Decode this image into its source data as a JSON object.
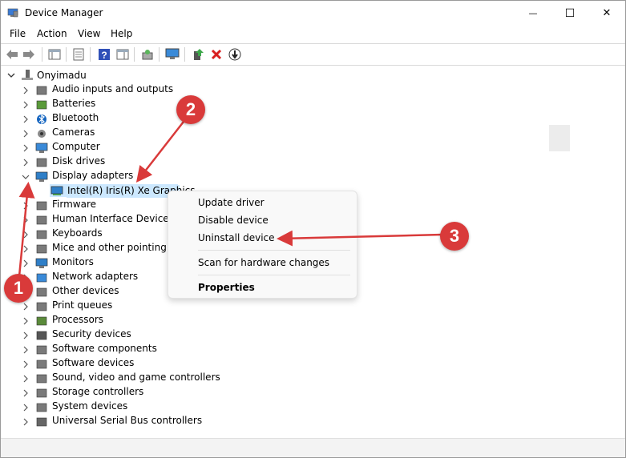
{
  "window": {
    "title": "Device Manager",
    "controls": {
      "minimize": "—",
      "maximize": "☐",
      "close": "✕"
    }
  },
  "menu": [
    "File",
    "Action",
    "View",
    "Help"
  ],
  "tree": {
    "root": "Onyimadu",
    "categories": [
      {
        "label": "Audio inputs and outputs",
        "icon": "speaker-icon"
      },
      {
        "label": "Batteries",
        "icon": "battery-icon"
      },
      {
        "label": "Bluetooth",
        "icon": "bluetooth-icon"
      },
      {
        "label": "Cameras",
        "icon": "camera-icon"
      },
      {
        "label": "Computer",
        "icon": "computer-icon"
      },
      {
        "label": "Disk drives",
        "icon": "disk-icon"
      },
      {
        "label": "Display adapters",
        "icon": "display-icon",
        "expanded": true
      },
      {
        "label": "Firmware",
        "icon": "chip-icon"
      },
      {
        "label": "Human Interface Devices",
        "icon": "hid-icon"
      },
      {
        "label": "Keyboards",
        "icon": "keyboard-icon"
      },
      {
        "label": "Mice and other pointing de",
        "icon": "mouse-icon"
      },
      {
        "label": "Monitors",
        "icon": "monitor-icon"
      },
      {
        "label": "Network adapters",
        "icon": "network-icon"
      },
      {
        "label": "Other devices",
        "icon": "unknown-device-icon"
      },
      {
        "label": "Print queues",
        "icon": "printer-icon"
      },
      {
        "label": "Processors",
        "icon": "processor-icon"
      },
      {
        "label": "Security devices",
        "icon": "security-icon"
      },
      {
        "label": "Software components",
        "icon": "component-icon"
      },
      {
        "label": "Software devices",
        "icon": "software-device-icon"
      },
      {
        "label": "Sound, video and game controllers",
        "icon": "sound-icon"
      },
      {
        "label": "Storage controllers",
        "icon": "storage-icon"
      },
      {
        "label": "System devices",
        "icon": "system-icon"
      },
      {
        "label": "Universal Serial Bus controllers",
        "icon": "usb-icon"
      }
    ],
    "selected_child": "Intel(R) Iris(R) Xe Graphics"
  },
  "context_menu": {
    "items": [
      "Update driver",
      "Disable device",
      "Uninstall device",
      "Scan for hardware changes",
      "Properties"
    ]
  },
  "annotations": [
    "1",
    "2",
    "3"
  ],
  "colors": {
    "annotation": "#d93a3a",
    "selection": "#cce8ff",
    "display_icon": "#2f7fc8",
    "uninstall_x": "#d81e1e"
  }
}
